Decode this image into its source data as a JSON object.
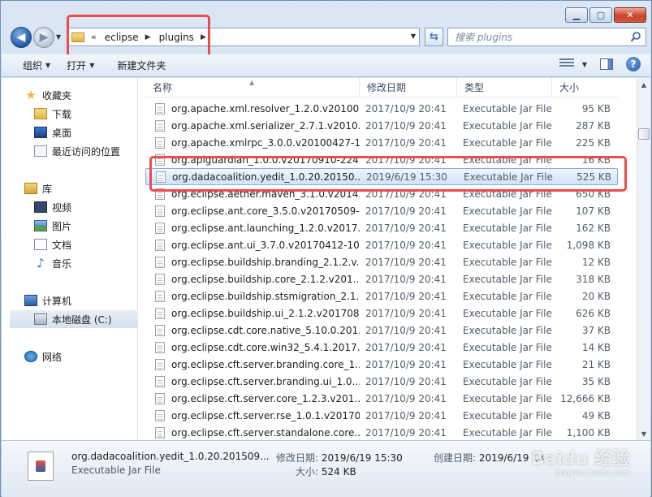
{
  "window": {
    "minimize_label": "▁",
    "maximize_label": "▢",
    "close_label": "✕"
  },
  "address": {
    "chevron": "«",
    "crumbs": [
      "eclipse",
      "plugins"
    ],
    "search_placeholder": "搜索 plugins"
  },
  "toolbar": {
    "organize_label": "组织",
    "open_label": "打开",
    "newfolder_label": "新建文件夹"
  },
  "sidebar": {
    "favorites": {
      "label": "收藏夹",
      "items": [
        "下载",
        "桌面",
        "最近访问的位置"
      ]
    },
    "libraries": {
      "label": "库",
      "items": [
        "视频",
        "图片",
        "文档",
        "音乐"
      ]
    },
    "computer": {
      "label": "计算机",
      "items": [
        "本地磁盘 (C:)"
      ]
    },
    "network": {
      "label": "网络"
    }
  },
  "columns": {
    "name": "名称",
    "date": "修改日期",
    "type": "类型",
    "size": "大小"
  },
  "files": [
    {
      "name": "org.apache.xml.resolver_1.2.0.v20100...",
      "date": "2017/10/9 20:41",
      "type": "Executable Jar File",
      "size": "95 KB"
    },
    {
      "name": "org.apache.xml.serializer_2.7.1.v2010...",
      "date": "2017/10/9 20:41",
      "type": "Executable Jar File",
      "size": "287 KB"
    },
    {
      "name": "org.apache.xmlrpc_3.0.0.v20100427-1...",
      "date": "2017/10/9 20:41",
      "type": "Executable Jar File",
      "size": "225 KB"
    },
    {
      "name": "org.apiguardian_1.0.0.v20170910-224...",
      "date": "2017/10/9 20:41",
      "type": "Executable Jar File",
      "size": "16 KB"
    },
    {
      "name": "org.dadacoalition.yedit_1.0.20.20150...",
      "date": "2019/6/19 15:30",
      "type": "Executable Jar File",
      "size": "525 KB"
    },
    {
      "name": "org.eclipse.aether.maven_3.1.0.v2014...",
      "date": "2017/10/9 20:41",
      "type": "Executable Jar File",
      "size": "650 KB"
    },
    {
      "name": "org.eclipse.ant.core_3.5.0.v20170509-...",
      "date": "2017/10/9 20:41",
      "type": "Executable Jar File",
      "size": "107 KB"
    },
    {
      "name": "org.eclipse.ant.launching_1.2.0.v2017...",
      "date": "2017/10/9 20:41",
      "type": "Executable Jar File",
      "size": "162 KB"
    },
    {
      "name": "org.eclipse.ant.ui_3.7.0.v20170412-10...",
      "date": "2017/10/9 20:41",
      "type": "Executable Jar File",
      "size": "1,098 KB"
    },
    {
      "name": "org.eclipse.buildship.branding_2.1.2.v...",
      "date": "2017/10/9 20:41",
      "type": "Executable Jar File",
      "size": "12 KB"
    },
    {
      "name": "org.eclipse.buildship.core_2.1.2.v201...",
      "date": "2017/10/9 20:41",
      "type": "Executable Jar File",
      "size": "318 KB"
    },
    {
      "name": "org.eclipse.buildship.stsmigration_2.1...",
      "date": "2017/10/9 20:41",
      "type": "Executable Jar File",
      "size": "20 KB"
    },
    {
      "name": "org.eclipse.buildship.ui_2.1.2.v201708...",
      "date": "2017/10/9 20:41",
      "type": "Executable Jar File",
      "size": "626 KB"
    },
    {
      "name": "org.eclipse.cdt.core.native_5.10.0.201...",
      "date": "2017/10/9 20:41",
      "type": "Executable Jar File",
      "size": "37 KB"
    },
    {
      "name": "org.eclipse.cdt.core.win32_5.4.1.2017...",
      "date": "2017/10/9 20:41",
      "type": "Executable Jar File",
      "size": "14 KB"
    },
    {
      "name": "org.eclipse.cft.server.branding.core_1...",
      "date": "2017/10/9 20:41",
      "type": "Executable Jar File",
      "size": "21 KB"
    },
    {
      "name": "org.eclipse.cft.server.branding.ui_1.0....",
      "date": "2017/10/9 20:41",
      "type": "Executable Jar File",
      "size": "35 KB"
    },
    {
      "name": "org.eclipse.cft.server.core_1.2.3.v201...",
      "date": "2017/10/9 20:41",
      "type": "Executable Jar File",
      "size": "12,666 KB"
    },
    {
      "name": "org.eclipse.cft.server.rse_1.0.1.v20170...",
      "date": "2017/10/9 20:41",
      "type": "Executable Jar File",
      "size": "49 KB"
    },
    {
      "name": "org.eclipse.cft.server.standalone.core....",
      "date": "2017/10/9 20:41",
      "type": "Executable Jar File",
      "size": "1,100 KB"
    }
  ],
  "selected_index": 4,
  "details": {
    "name": "org.dadacoalition.yedit_1.0.20.201509...",
    "type": "Executable Jar File",
    "modified_label": "修改日期:",
    "modified_value": "2019/6/19 15:30",
    "created_label": "创建日期:",
    "created_value": "2019/6/19 14",
    "size_label": "大小:",
    "size_value": "524 KB"
  },
  "watermark": {
    "main": "Baidu 经验",
    "sub": "jingyan.baidu.com"
  },
  "colors": {
    "annotation": "#ec4c4c",
    "selection": "#cfe3fa",
    "accent": "#1f5aa6"
  }
}
